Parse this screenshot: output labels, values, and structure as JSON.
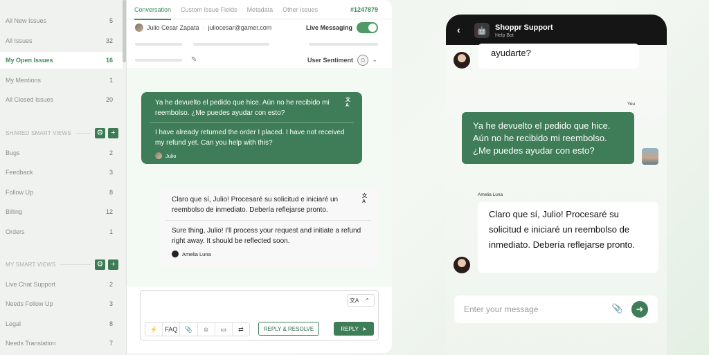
{
  "sidebar": {
    "items": [
      {
        "label": "All New Issues",
        "count": "5"
      },
      {
        "label": "All Issues",
        "count": "32"
      },
      {
        "label": "My Open Issues",
        "count": "16"
      },
      {
        "label": "My Mentions",
        "count": "1"
      },
      {
        "label": "All Closed Issues",
        "count": "20"
      }
    ],
    "shared_title": "SHARED SMART VIEWS",
    "shared_items": [
      {
        "label": "Bugs",
        "count": "2"
      },
      {
        "label": "Feedback",
        "count": "3"
      },
      {
        "label": "Follow Up",
        "count": "8"
      },
      {
        "label": "Billing",
        "count": "12"
      },
      {
        "label": "Orders",
        "count": "1"
      }
    ],
    "my_title": "MY SMART VIEWS",
    "my_items": [
      {
        "label": "Live Chat Support",
        "count": "2"
      },
      {
        "label": "Needs Follow Up",
        "count": "3"
      },
      {
        "label": "Legal",
        "count": "8"
      },
      {
        "label": "Needs Translation",
        "count": "7"
      }
    ],
    "gear_icon": "⚙",
    "plus_icon": "+"
  },
  "main": {
    "tabs": [
      "Conversation",
      "Custom Issue Fields",
      "Metadata",
      "Other Issues"
    ],
    "ticket_id": "#1247879",
    "user_name": "Julio Cesar Zapata",
    "user_email": "juliocesar@gamer.com",
    "separator": "·",
    "live_label": "Live Messaging",
    "sentiment_label": "User Sentiment",
    "sentiment_icon": "☺",
    "chevron": "⌄",
    "pencil": "✎"
  },
  "messages": {
    "customer_original": "Ya he devuelto el pedido que hice. Aún no he recibido mi reembolso. ¿Me puedes ayudar con esto?",
    "customer_translated": "I have already returned the order I placed. I have not received my refund yet. Can you help with this?",
    "customer_name": "Julio",
    "agent_original": "Claro que sí, Julio! Procesaré su solicitud e iniciaré un reembolso de inmediato. Debería reflejarse pronto.",
    "agent_translated": "Sure thing, Julio! I'll process your request and initiate a refund right away. It should be reflected soon.",
    "agent_name": "Amelia Luna",
    "translate_icon": "文A"
  },
  "composer": {
    "tools": [
      "⚡",
      "FAQ",
      "📎",
      "☺",
      "▭",
      "⇄"
    ],
    "translate_icon": "文A",
    "collapse_icon": "⌃",
    "reply_resolve": "REPLY & RESOLVE",
    "reply": "REPLY",
    "send_icon": "➤"
  },
  "phone": {
    "back": "‹",
    "bot_icon": "🤖",
    "title": "Shoppr Support",
    "subtitle": "Help Bot",
    "top_message": "ayudarte?",
    "you_label": "You",
    "user_message": "Ya he devuelto el pedido que hice. Aún no he recibido mi reembolso. ¿Me puedes ayudar con esto?",
    "agent_name": "Amelia Luna",
    "agent_message": "Claro que sí, Julio! Procesaré su solicitud e iniciaré un reembolso de inmediato. Debería reflejarse pronto.",
    "input_placeholder": "Enter your message",
    "clip_icon": "📎",
    "send_icon": "➜"
  },
  "colors": {
    "accent": "#3e7d57",
    "active_text": "#3d8a5c",
    "header_dark": "#151515"
  }
}
